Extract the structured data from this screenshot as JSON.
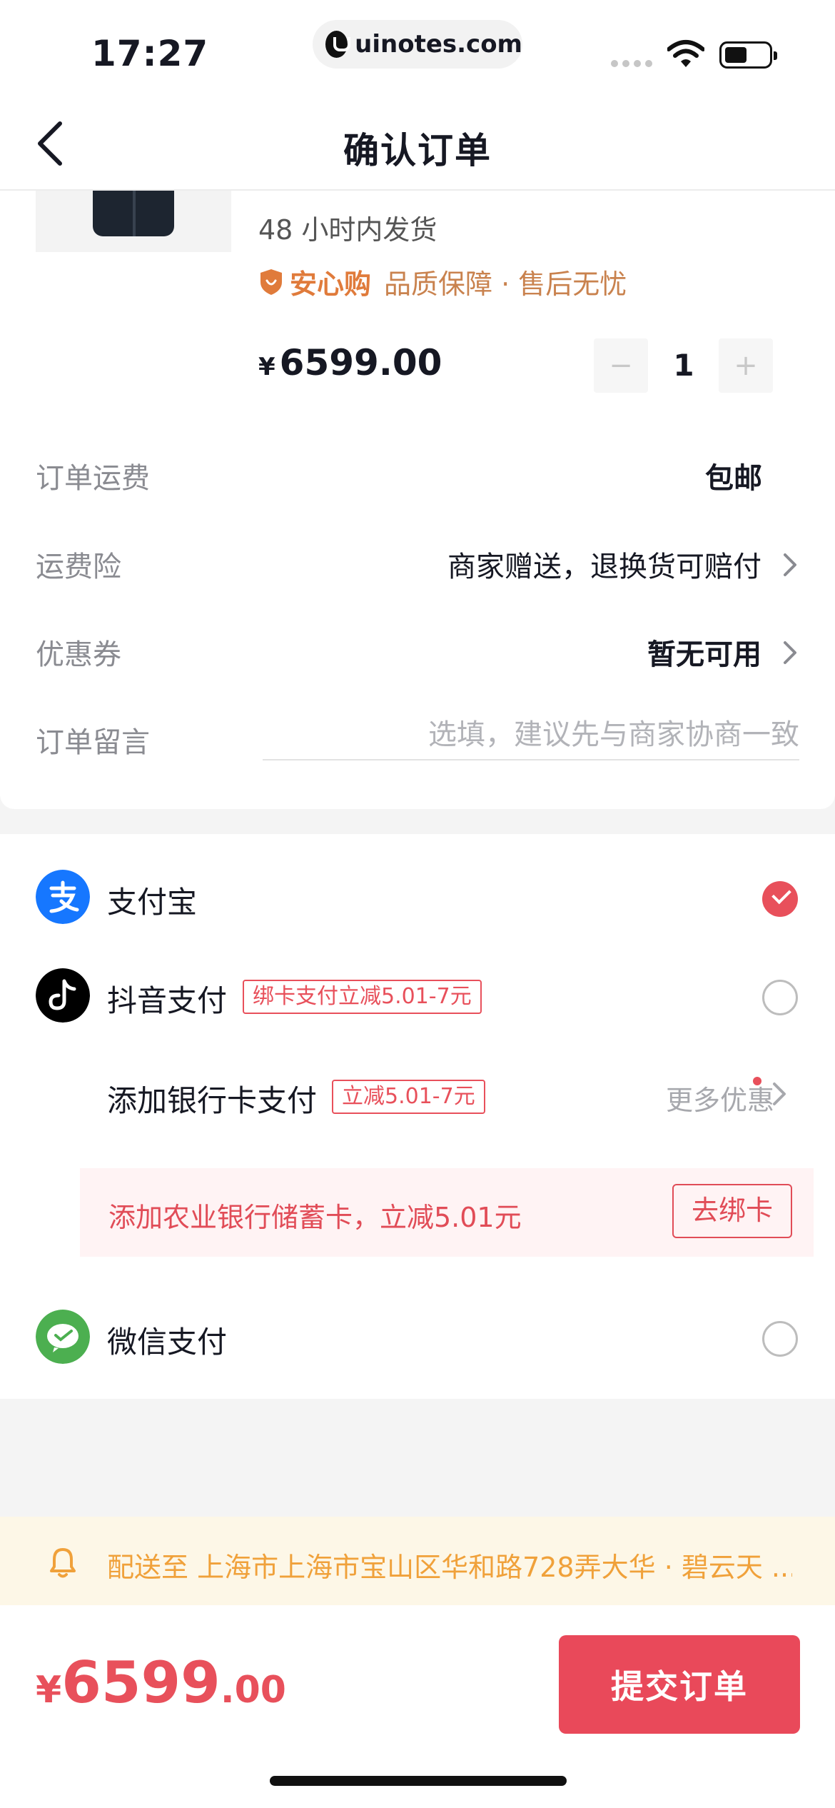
{
  "status_bar": {
    "time": "17:27",
    "url": "uinotes.com"
  },
  "nav": {
    "title": "确认订单",
    "back_icon": "chevron-left-icon"
  },
  "product": {
    "delivery": "48 小时内发货",
    "guarantee_brand": "安心购",
    "guarantee_text": "品质保障 · 售后无忧",
    "price_currency": "¥",
    "price": "6599.00",
    "qty_minus": "−",
    "qty_plus": "+",
    "quantity": "1"
  },
  "order_rows": [
    {
      "label": "订单运费",
      "value": "包邮"
    },
    {
      "label": "运费险",
      "value": "商家赠送，退换货可赔付"
    },
    {
      "label": "优惠券",
      "value": "暂无可用"
    },
    {
      "label": "订单留言",
      "placeholder": "选填，建议先与商家协商一致"
    }
  ],
  "payment": {
    "alipay": {
      "label": "支付宝",
      "selected": true
    },
    "douyin": {
      "label": "抖音支付",
      "promo": "绑卡支付立减5.01-7元",
      "selected": false
    },
    "bank": {
      "label": "添加银行卡支付",
      "promo": "立减5.01-7元",
      "more": "更多优惠"
    },
    "bind_banner": {
      "text": "添加农业银行储蓄卡，立减5.01元",
      "button": "去绑卡"
    },
    "wechat": {
      "label": "微信支付",
      "selected": false
    }
  },
  "address": {
    "text": "配送至 上海市上海市宝山区华和路728弄大华 · 碧云天 ..."
  },
  "footer": {
    "total_currency": "¥",
    "total_int": "6599",
    "total_dec": ".00",
    "submit": "提交订单"
  },
  "colors": {
    "accent": "#e9495a",
    "alipay": "#1677ff",
    "wechat": "#4caf50",
    "guarantee": "#e07b3b",
    "address": "#f0a13a"
  }
}
